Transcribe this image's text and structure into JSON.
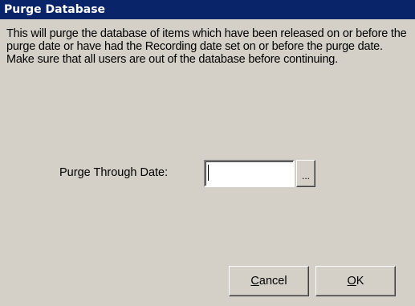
{
  "window": {
    "title": "Purge Database"
  },
  "description": "This will purge the database of items which have been released on or before the purge date or have had the Recording date set on or before the purge date. Make sure that all users are out of the database before continuing.",
  "purge_date": {
    "label": "Purge Through Date:",
    "value": "",
    "browse_label": "..."
  },
  "buttons": {
    "cancel": {
      "mnemonic": "C",
      "rest": "ancel"
    },
    "ok": {
      "mnemonic": "O",
      "rest": "K"
    }
  },
  "colors": {
    "titlebar": "#0a246a",
    "face": "#d4d0c8",
    "title_text": "#ffffff"
  }
}
